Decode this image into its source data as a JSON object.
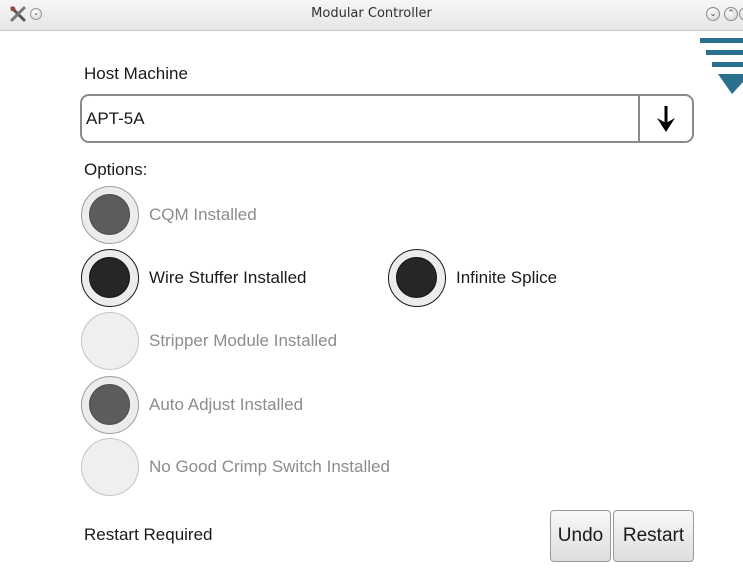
{
  "window": {
    "title": "Modular Controller"
  },
  "host_machine": {
    "label": "Host Machine",
    "selected_value": "APT-5A"
  },
  "options": {
    "label": "Options:",
    "items": [
      {
        "label": "CQM Installed",
        "checked": true,
        "enabled": false
      },
      {
        "label": "Wire Stuffer Installed",
        "checked": true,
        "enabled": true
      },
      {
        "label": "Infinite Splice",
        "checked": true,
        "enabled": true
      },
      {
        "label": "Stripper Module Installed",
        "checked": false,
        "enabled": false
      },
      {
        "label": "Auto Adjust Installed",
        "checked": true,
        "enabled": false
      },
      {
        "label": "No Good Crimp Switch Installed",
        "checked": false,
        "enabled": false
      }
    ]
  },
  "footer": {
    "status": "Restart Required",
    "undo_label": "Undo",
    "restart_label": "Restart"
  },
  "icons": {
    "titlebar_app": "crossed-tools-icon",
    "window_menu": "window-menu-icon",
    "minimize": "minimize-icon",
    "maximize": "maximize-icon",
    "close": "close-icon",
    "dropdown": "arrow-down-icon",
    "corner_logo": "logo-icon"
  },
  "colors": {
    "logo": "#2a6f8e",
    "checked_fill": "#262626",
    "disabled_fill": "#5c5c5c",
    "disabled_text": "#8c8c8c"
  }
}
